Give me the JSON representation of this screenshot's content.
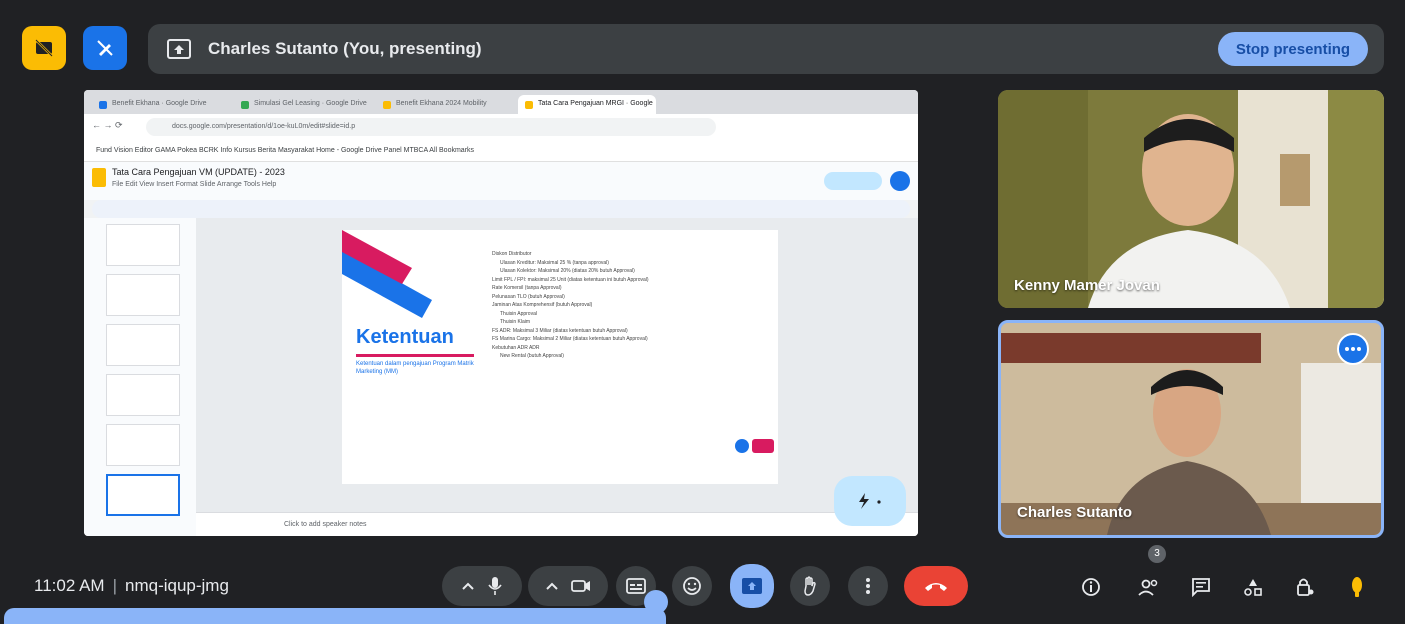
{
  "top_bar": {
    "presenting_text": "Charles Sutanto (You, presenting)",
    "stop_label": "Stop presenting"
  },
  "shared_screen": {
    "tabs": [
      {
        "label": "Benefit Ekhana · Google Drive"
      },
      {
        "label": "Simulasi Gel Leasing · Google Drive"
      },
      {
        "label": "Benefit Ekhana 2024 Mobility"
      },
      {
        "label": "Tata Cara Pengajuan MRGI · Google"
      }
    ],
    "url": "docs.google.com/presentation/d/1oe-kuL0m/edit#slide=id.p",
    "bookmarks": "Fund Vision Editor   GAMA   Pokea   BCRK   Info Kursus   Berita Masyarakat   Home - Google Drive   Panel   MTBCA   All Bookmarks",
    "doc_title": "Tata Cara Pengajuan VM (UPDATE) - 2023",
    "doc_menu": "File  Edit  View  Insert  Format  Slide  Arrange  Tools  Help",
    "slide": {
      "title": "Ketentuan",
      "subtitle": "Ketentuan dalam pengajuan Program Matrik Marketing (MM)",
      "list": [
        "Diskon Distributor",
        "Ulasan Kreditur: Maksimal 25 % (tanpa approval)",
        "Ulasan Kolektor: Maksimal 20% (diatas 20% butuh Approval)",
        "Limit FPL / FPI: maksimal 25 Unit (diatas ketentuan ini butuh Approval)",
        "Rate Komersil (tanpa Approval)",
        "Pelunasan TLO (butuh Approval)",
        "Jaminan Atas Komprehensif (butuh Approval)",
        "Thuisin Approval",
        "Thuisin Klaim",
        "FS ADR: Maksimal 3 Miliar (diatas ketentuan butuh Approval)",
        "FS Marina Cargo: Maksimal 2 Miliar (diatas ketentuan butuh Approval)",
        "Kebutuhan ADR ADR",
        "New Rental (butuh Approval)"
      ]
    },
    "notes_placeholder": "Click to add speaker notes"
  },
  "participants": [
    {
      "name": "Kenny Mamer Jovan"
    },
    {
      "name": "Charles Sutanto"
    }
  ],
  "bottom_bar": {
    "time": "11:02 AM",
    "separator": "|",
    "meeting_code": "nmq-iqup-jmg",
    "people_count": "3"
  },
  "colors": {
    "background": "#202124",
    "accent_blue": "#8ab4f8",
    "end_call_red": "#ea4335",
    "yellow": "#fbbc04"
  }
}
